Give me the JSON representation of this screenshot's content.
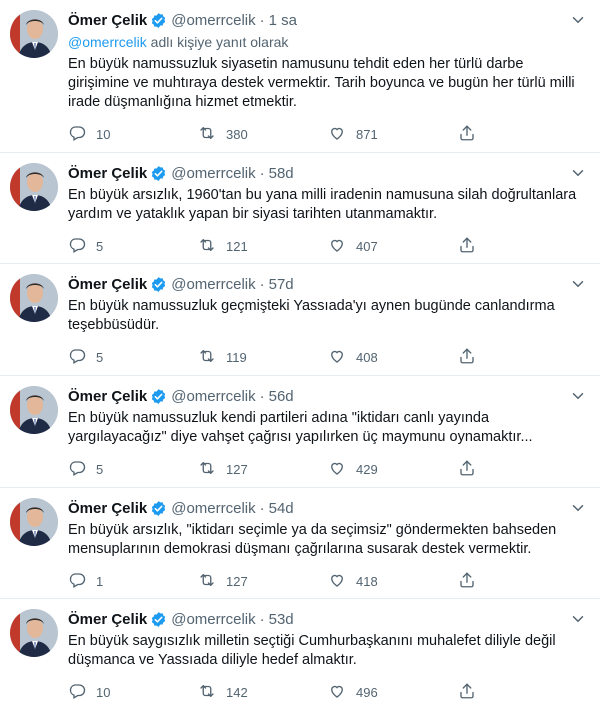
{
  "tweets": [
    {
      "name": "Ömer Çelik",
      "handle": "@omerrcelik",
      "time": "1 sa",
      "reply_prefix": "@omerrcelik",
      "reply_suffix": " adlı kişiye yanıt olarak",
      "text": "En büyük namussuzluk siyasetin namusunu tehdit eden her türlü darbe girişimine ve muhtıraya destek vermektir. Tarih boyunca ve bugün her türlü milli irade düşmanlığına hizmet etmektir.",
      "replies": "10",
      "retweets": "380",
      "likes": "871"
    },
    {
      "name": "Ömer Çelik",
      "handle": "@omerrcelik",
      "time": "58d",
      "text": "En büyük arsızlık, 1960'tan bu yana milli iradenin namusuna silah doğrultanlara yardım ve yataklık yapan bir siyasi tarihten utanmamaktır.",
      "replies": "5",
      "retweets": "121",
      "likes": "407"
    },
    {
      "name": "Ömer Çelik",
      "handle": "@omerrcelik",
      "time": "57d",
      "text": "En büyük namussuzluk geçmişteki Yassıada'yı aynen bugünde canlandırma teşebbüsüdür.",
      "replies": "5",
      "retweets": "119",
      "likes": "408"
    },
    {
      "name": "Ömer Çelik",
      "handle": "@omerrcelik",
      "time": "56d",
      "text": "En büyük namussuzluk kendi partileri adına \"iktidarı canlı yayında yargılayacağız\" diye vahşet çağrısı yapılırken üç maymunu oynamaktır...",
      "replies": "5",
      "retweets": "127",
      "likes": "429"
    },
    {
      "name": "Ömer Çelik",
      "handle": "@omerrcelik",
      "time": "54d",
      "text": "En büyük arsızlık, \"iktidarı seçimle ya da seçimsiz\" göndermekten bahseden mensuplarının demokrasi düşmanı çağrılarına susarak destek vermektir.",
      "replies": "1",
      "retweets": "127",
      "likes": "418"
    },
    {
      "name": "Ömer Çelik",
      "handle": "@omerrcelik",
      "time": "53d",
      "text": "En büyük saygısızlık milletin seçtiği Cumhurbaşkanını muhalefet diliyle değil düşmanca ve Yassıada diliyle hedef almaktır.",
      "replies": "10",
      "retweets": "142",
      "likes": "496"
    }
  ],
  "icons": {
    "verified": "verified-badge-icon",
    "more": "more-options-icon",
    "reply": "reply-icon",
    "retweet": "retweet-icon",
    "like": "heart-icon",
    "share": "share-icon"
  },
  "colors": {
    "accent": "#1d9bf0",
    "muted": "#536471",
    "text": "#0f1419",
    "divider": "#e6ecf0"
  }
}
